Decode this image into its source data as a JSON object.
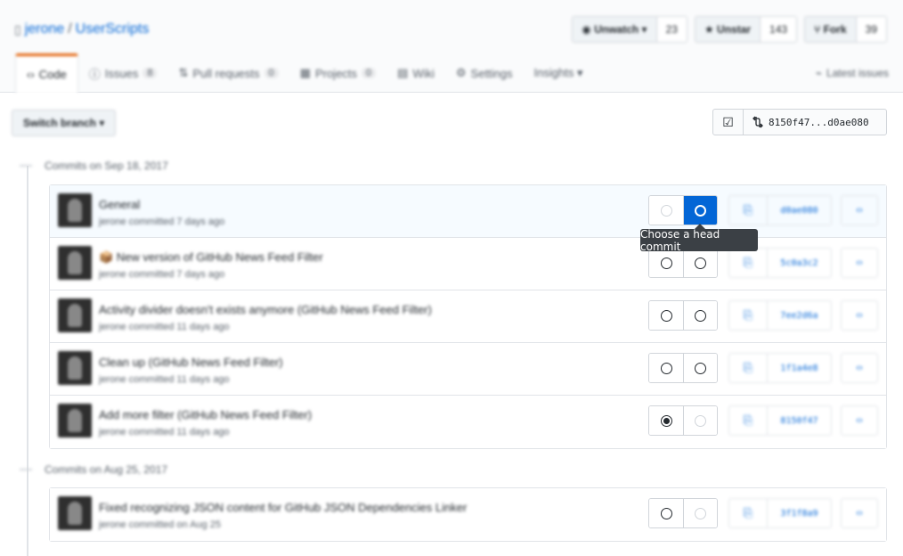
{
  "repo": {
    "owner": "jerone",
    "separator": "/",
    "name": "UserScripts"
  },
  "actions": [
    {
      "label": "Unwatch ▾",
      "count": "23"
    },
    {
      "label": "Unstar",
      "count": "143"
    },
    {
      "label": "Fork",
      "count": "39"
    }
  ],
  "tabs": [
    {
      "label": "Code",
      "count": ""
    },
    {
      "label": "Issues",
      "count": "8"
    },
    {
      "label": "Pull requests",
      "count": "0"
    },
    {
      "label": "Projects",
      "count": "0"
    },
    {
      "label": "Wiki",
      "count": ""
    },
    {
      "label": "Settings",
      "count": ""
    },
    {
      "label": "Insights ▾",
      "count": ""
    }
  ],
  "tab_right": "Latest issues",
  "toolbar": {
    "switch_label": "Switch branch ▾",
    "compare_check": "☑",
    "compare_range": "8150f47...d0ae080"
  },
  "groups": [
    {
      "title": "Commits on Sep 18, 2017",
      "commits": [
        {
          "message": "General",
          "meta": "jerone committed 7 days ago",
          "sha": "d0ae080"
        },
        {
          "message": "📦 New version of GitHub News Feed Filter",
          "meta": "jerone committed 7 days ago",
          "sha": "5c0a3c2"
        },
        {
          "message": "Activity divider doesn't exists anymore (GitHub News Feed Filter)",
          "meta": "jerone committed 11 days ago",
          "sha": "7ee2d6a"
        },
        {
          "message": "Clean up (GitHub News Feed Filter)",
          "meta": "jerone committed 11 days ago",
          "sha": "1f1a4e8"
        },
        {
          "message": "Add more filter (GitHub News Feed Filter)",
          "meta": "jerone committed 11 days ago",
          "sha": "8150f47"
        }
      ]
    },
    {
      "title": "Commits on Aug 25, 2017",
      "commits": [
        {
          "message": "Fixed recognizing JSON content for GitHub JSON Dependencies Linker",
          "meta": "jerone committed on Aug 25",
          "sha": "3f1f8a9"
        }
      ]
    }
  ],
  "tooltip": "Choose a head commit",
  "icons": {
    "book": "book-icon",
    "eye": "eye-icon",
    "star": "star-icon",
    "fork": "fork-icon",
    "code": "code-icon",
    "issue": "issue-icon",
    "pr": "pull-request-icon",
    "project": "project-icon",
    "wiki": "wiki-icon",
    "gear": "gear-icon",
    "graph": "graph-icon",
    "clipboard": "clipboard-icon",
    "compare": "compare-icon",
    "browse": "code-browse-icon",
    "check": "checkbox-icon"
  },
  "colors": {
    "link": "#0366d6",
    "tab_accent": "#e36209",
    "tooltip_bg": "#3b4045",
    "active_radio": "#0366d6"
  }
}
